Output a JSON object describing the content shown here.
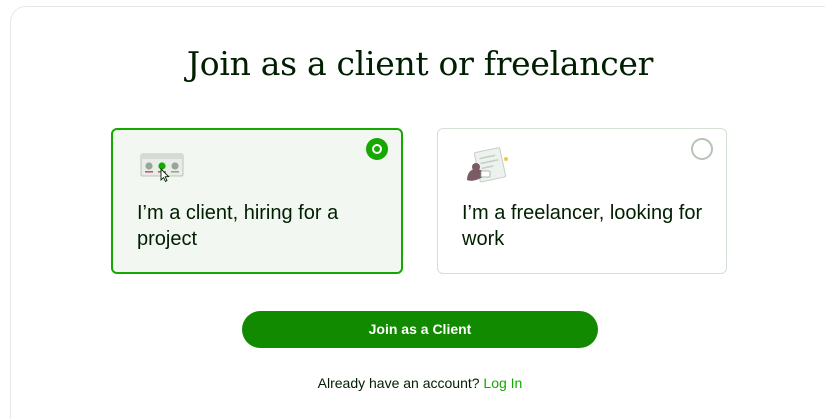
{
  "heading": "Join as a client or freelancer",
  "options": [
    {
      "id": "client",
      "label": "I’m a client, hiring for a project",
      "icon": "client-browser-icon",
      "selected": true
    },
    {
      "id": "freelancer",
      "label": "I’m a freelancer, looking for work",
      "icon": "freelancer-document-icon",
      "selected": false
    }
  ],
  "cta": {
    "label": "Join as a Client"
  },
  "login": {
    "prompt": "Already have an account?",
    "link_label": "Log In"
  },
  "colors": {
    "brand_green": "#14a800",
    "button_green": "#118a00",
    "selected_card_bg": "#f2f7f2",
    "text": "#001e00",
    "border": "#d5e0d5"
  }
}
